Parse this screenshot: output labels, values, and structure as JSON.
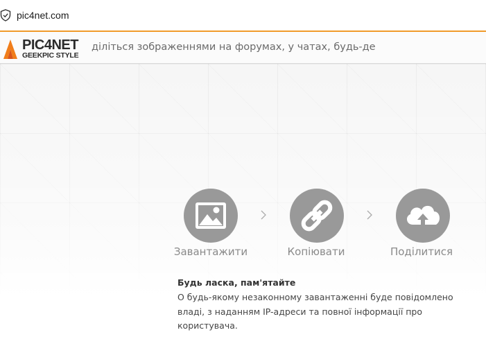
{
  "browser": {
    "url": "pic4net.com",
    "security_icon": "shield-check-icon"
  },
  "header": {
    "logo_main": "PIC4NET",
    "logo_sub": "GEEKPIC STYLE",
    "tagline": "діліться зображеннями на форумах, у чатах, будь-де",
    "accent_color": "#f09a2a"
  },
  "steps": [
    {
      "label": "Завантажити",
      "icon": "image-icon"
    },
    {
      "label": "Копіювати",
      "icon": "link-icon"
    },
    {
      "label": "Поділитися",
      "icon": "cloud-upload-icon"
    }
  ],
  "notice": {
    "title": "Будь ласка, пам'ятайте",
    "body": "О будь-якому незаконному завантаженні буде повідомлено владі, з наданням IP-адреси та повної інформації про користувача."
  }
}
